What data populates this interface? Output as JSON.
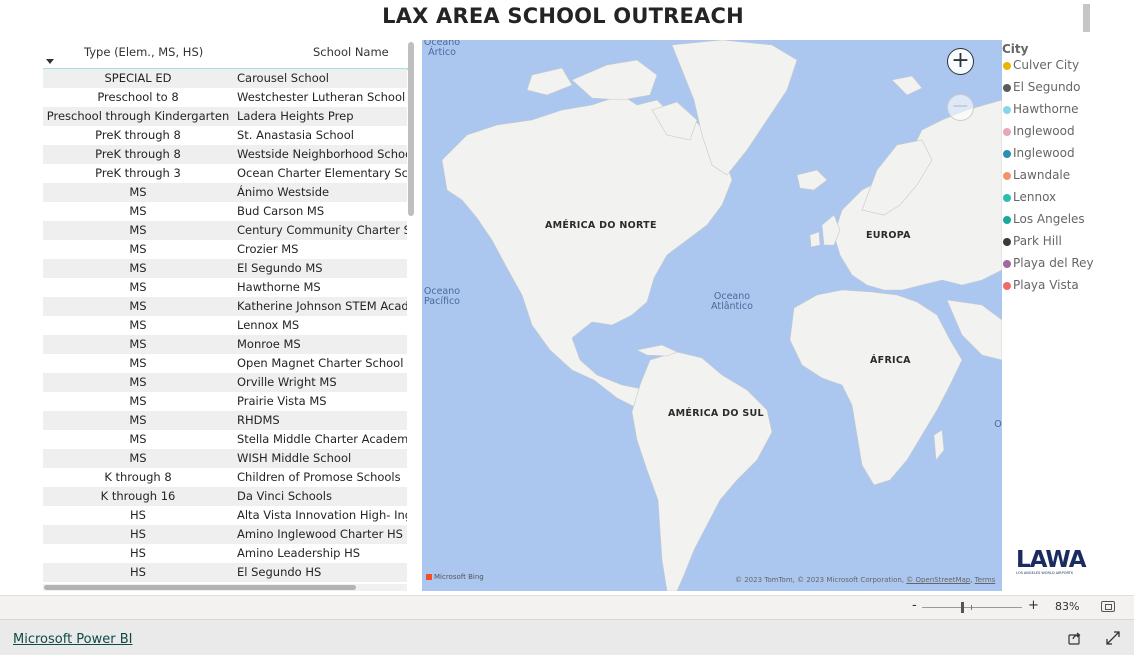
{
  "header": {
    "title": "LAX AREA SCHOOL OUTREACH"
  },
  "table": {
    "columns": [
      "Type (Elem., MS, HS)",
      "School Name"
    ],
    "rows": [
      {
        "type": "SPECIAL ED",
        "name": "Carousel School"
      },
      {
        "type": "Preschool to 8",
        "name": "Westchester Lutheran School"
      },
      {
        "type": "Preschool through Kindergarten",
        "name": "Ladera Heights Prep"
      },
      {
        "type": "PreK through 8",
        "name": "St. Anastasia School"
      },
      {
        "type": "PreK through 8",
        "name": "Westside Neighborhood School"
      },
      {
        "type": "PreK through 3",
        "name": "Ocean Charter Elementary School"
      },
      {
        "type": "MS",
        "name": "Ánimo Westside"
      },
      {
        "type": "MS",
        "name": "Bud Carson MS"
      },
      {
        "type": "MS",
        "name": "Century Community Charter School"
      },
      {
        "type": "MS",
        "name": "Crozier MS"
      },
      {
        "type": "MS",
        "name": "El Segundo MS"
      },
      {
        "type": "MS",
        "name": "Hawthorne MS"
      },
      {
        "type": "MS",
        "name": "Katherine Johnson STEM Academy"
      },
      {
        "type": "MS",
        "name": "Lennox MS"
      },
      {
        "type": "MS",
        "name": "Monroe MS"
      },
      {
        "type": "MS",
        "name": "Open Magnet Charter School"
      },
      {
        "type": "MS",
        "name": "Orville Wright MS"
      },
      {
        "type": "MS",
        "name": "Prairie Vista MS"
      },
      {
        "type": "MS",
        "name": "RHDMS"
      },
      {
        "type": "MS",
        "name": "Stella Middle Charter Academy"
      },
      {
        "type": "MS",
        "name": "WISH Middle School"
      },
      {
        "type": "K through 8",
        "name": "Children of Promose Schools"
      },
      {
        "type": "K through 16",
        "name": "Da Vinci Schools"
      },
      {
        "type": "HS",
        "name": "Alta Vista Innovation High- Inglewood"
      },
      {
        "type": "HS",
        "name": "Amino Inglewood Charter HS"
      },
      {
        "type": "HS",
        "name": "Amino Leadership HS"
      },
      {
        "type": "HS",
        "name": "El Segundo HS"
      }
    ]
  },
  "map": {
    "labels": {
      "north_america": "AMÉRICA DO NORTE",
      "europe": "EUROPA",
      "africa": "ÁFRICA",
      "south_america": "AMÉRICA DO SUL",
      "arctic_ocean": "Oceano Ártico",
      "pacific_ocean": "Oceano Pacífico",
      "atlantic_ocean": "Oceano Atlântico",
      "ocean_fragment": "O"
    },
    "zoom_in": "+",
    "zoom_out": "−",
    "bing": "Microsoft Bing",
    "attribution": "© 2023 TomTom, © 2023 Microsoft Corporation, ",
    "osm": "© OpenStreetMap",
    "terms": "Terms",
    "colors": {
      "water": "#abc7f0",
      "land": "#f2f2f0"
    }
  },
  "legend": {
    "title": "City",
    "items": [
      {
        "label": "Culver City",
        "color": "#e8b600"
      },
      {
        "label": "El Segundo",
        "color": "#5a5a5a"
      },
      {
        "label": "Hawthorne",
        "color": "#8ad4eb"
      },
      {
        "label": "Inglewood",
        "color": "#e8a8b8"
      },
      {
        "label": "Inglewood",
        "color": "#2a8fb0"
      },
      {
        "label": "Lawndale",
        "color": "#f0956a"
      },
      {
        "label": "Lennox",
        "color": "#2ac0b0"
      },
      {
        "label": "Los Angeles",
        "color": "#1aa89a"
      },
      {
        "label": "Park Hill",
        "color": "#3a3a3a"
      },
      {
        "label": "Playa del Rey",
        "color": "#a06a9a"
      },
      {
        "label": "Playa Vista",
        "color": "#f06a6a"
      }
    ]
  },
  "logo": {
    "text": "LAWA",
    "sub": "LOS ANGELES WORLD AIRPORTS"
  },
  "zoombar": {
    "minus": "-",
    "plus": "+",
    "percent": "83%"
  },
  "footer": {
    "link": "Microsoft Power BI"
  }
}
